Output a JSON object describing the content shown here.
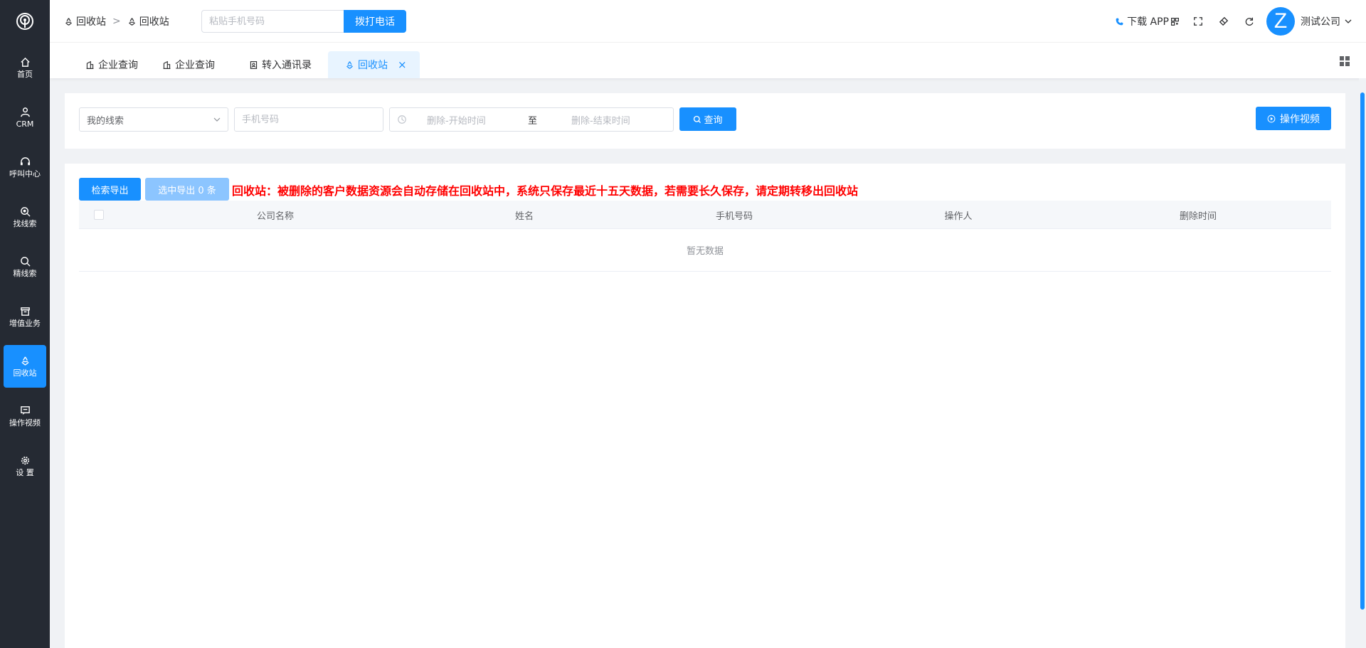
{
  "sidebar": {
    "items": [
      {
        "label": "首页",
        "icon": "home-icon"
      },
      {
        "label": "CRM",
        "icon": "user-icon"
      },
      {
        "label": "呼叫中心",
        "icon": "headset-icon"
      },
      {
        "label": "找线索",
        "icon": "zoom-search-icon"
      },
      {
        "label": "精线索",
        "icon": "search-icon"
      },
      {
        "label": "增值业务",
        "icon": "archive-icon"
      },
      {
        "label": "回收站",
        "icon": "recycle-icon",
        "active": true
      },
      {
        "label": "操作视频",
        "icon": "message-icon"
      },
      {
        "label": "设 置",
        "icon": "gear-icon"
      }
    ]
  },
  "header": {
    "breadcrumb": [
      "回收站",
      "回收站"
    ],
    "breadcrumb_sep": ">",
    "phone_placeholder": "粘贴手机号码",
    "dial_label": "拨打电话",
    "download_label": "下载 APP",
    "company_name": "测试公司",
    "avatar_letter": "Z"
  },
  "tabs": [
    {
      "label": "企业查询"
    },
    {
      "label": "企业查询"
    },
    {
      "label": "转入通讯录"
    },
    {
      "label": "回收站",
      "active": true,
      "close": "×"
    }
  ],
  "filters": {
    "source_select": "我的线索",
    "mobile_placeholder": "手机号码",
    "date_start_placeholder": "删除-开始时间",
    "date_separator": "至",
    "date_end_placeholder": "删除-结束时间",
    "query_label": "查询",
    "video_label": "操作视频"
  },
  "toolbar": {
    "export_label": "检索导出",
    "export_selected_label": "选中导出 0 条",
    "notice": "回收站：被删除的客户数据资源会自动存储在回收站中，系统只保存最近十五天数据，若需要长久保存，请定期转移出回收站"
  },
  "table": {
    "columns": [
      "公司名称",
      "姓名",
      "手机号码",
      "操作人",
      "删除时间"
    ],
    "empty_text": "暂无数据"
  },
  "colors": {
    "primary": "#1890ff",
    "sidebar_bg": "#252a33",
    "notice": "#ff0000"
  }
}
